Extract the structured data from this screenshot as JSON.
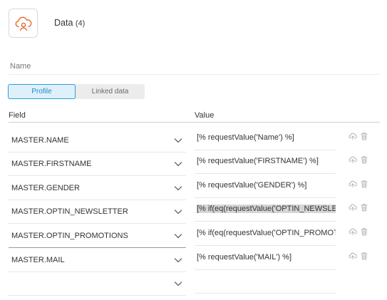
{
  "header": {
    "title": "Data",
    "count": "(4)",
    "icon": "cloud-user-icon",
    "accent_color": "#e86a2e"
  },
  "name_field": {
    "label": "Name"
  },
  "tabs": [
    {
      "label": "Profile",
      "active": true
    },
    {
      "label": "Linked data",
      "active": false
    }
  ],
  "columns": {
    "field": "Field",
    "value": "Value"
  },
  "rows": [
    {
      "field": "MASTER.NAME",
      "value": "[% requestValue('Name') %]"
    },
    {
      "field": "MASTER.FIRSTNAME",
      "value": "[% requestValue('FIRSTNAME') %]"
    },
    {
      "field": "MASTER.GENDER",
      "value": "[% requestValue('GENDER') %]"
    },
    {
      "field": "MASTER.OPTIN_NEWSLETTER",
      "value": "[% if(eq(requestValue('OPTIN_NEWSLETTER"
    },
    {
      "field": "MASTER.OPTIN_PROMOTIONS",
      "value": "[% if(eq(requestValue('OPTIN_PROMOTIONS"
    },
    {
      "field": "MASTER.MAIL",
      "value": "[% requestValue('MAIL') %]"
    },
    {
      "field": "",
      "value": ""
    }
  ],
  "colors": {
    "tab_active_border": "#2aa1da",
    "tab_active_bg": "#dff0fa"
  }
}
